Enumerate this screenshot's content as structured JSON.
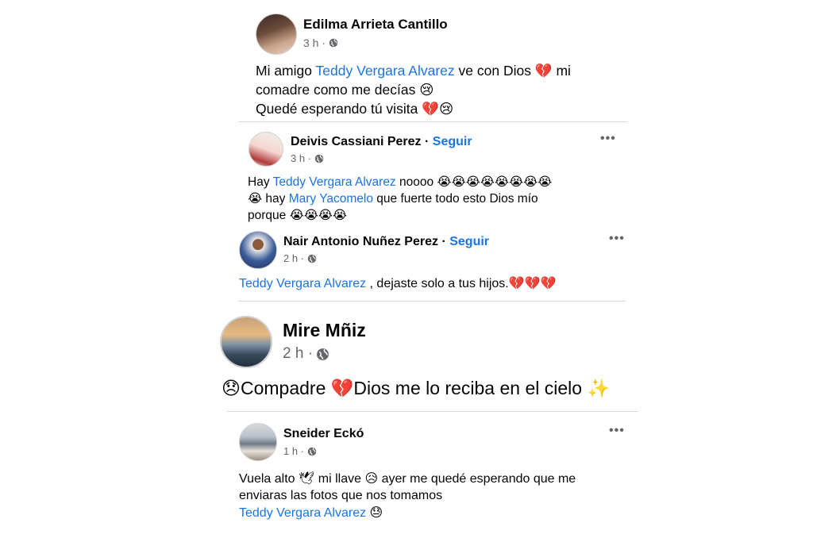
{
  "posts": [
    {
      "author": "Edilma Arrieta Cantillo",
      "time": "3 h ·",
      "lines": [
        [
          {
            "t": "Mi amigo "
          },
          {
            "m": "Teddy Vergara Alvarez"
          },
          {
            "t": "  ve con Dios "
          },
          {
            "e": "💔"
          },
          {
            "t": " mi"
          }
        ],
        [
          {
            "t": "comadre como me decías "
          },
          {
            "e": "😢"
          }
        ],
        [
          {
            "t": "Quedé esperando tú visita "
          },
          {
            "e": "💔😢"
          }
        ]
      ]
    },
    {
      "author": "Deivis Cassiani Perez",
      "follow": "Seguir",
      "time": "3 h ·",
      "lines": [
        [
          {
            "t": "Hay "
          },
          {
            "m": "Teddy Vergara Alvarez"
          },
          {
            "t": " noooo "
          },
          {
            "e": "😭😭😭😭😭😭😭😭"
          }
        ],
        [
          {
            "e": "😭"
          },
          {
            "t": " hay "
          },
          {
            "m": "Mary Yacomelo"
          },
          {
            "t": " que fuerte todo esto Dios mío"
          }
        ],
        [
          {
            "t": "porque "
          },
          {
            "e": "😭😭😭😭"
          }
        ]
      ]
    },
    {
      "author": "Nair Antonio Nuñez Perez",
      "follow": "Seguir",
      "time": "2 h ·",
      "lines": [
        [
          {
            "m": "Teddy Vergara Alvarez"
          },
          {
            "t": " , dejaste solo a tus hijos."
          },
          {
            "e": "💔💔💔"
          }
        ]
      ]
    },
    {
      "author": "Mire Mñiz",
      "time": "2 h ·",
      "lines": [
        [
          {
            "e": "😞"
          },
          {
            "t": "Compadre "
          },
          {
            "e": "💔"
          },
          {
            "t": "Dios me lo reciba en el cielo "
          },
          {
            "e": "✨"
          }
        ]
      ]
    },
    {
      "author": "Sneider Eckó",
      "time": "1 h ·",
      "lines": [
        [
          {
            "t": "Vuela alto "
          },
          {
            "e": "🕊"
          },
          {
            "t": " mi llave "
          },
          {
            "e": "😥"
          },
          {
            "t": "  ayer  me quedé esperando que me"
          }
        ],
        [
          {
            "t": "enviaras las fotos que nos tomamos"
          }
        ],
        [
          {
            "m": "Teddy Vergara Alvarez"
          },
          {
            "t": " "
          },
          {
            "e": "😓"
          }
        ]
      ]
    }
  ],
  "colors": {
    "mention": "#1b74e4",
    "meta": "#65676b"
  },
  "icons": {
    "privacy": "globe-icon",
    "more": "more-options-icon"
  }
}
